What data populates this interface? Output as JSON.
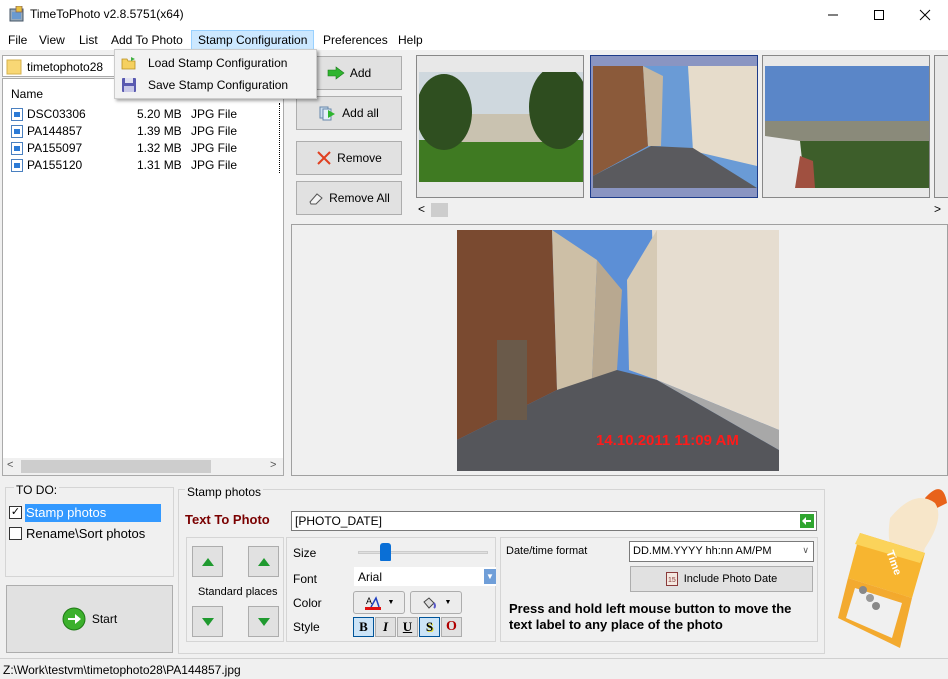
{
  "window": {
    "title": "TimeToPhoto v2.8.5751(x64)",
    "controls": {
      "minimize": "—",
      "maximize": "☐",
      "close": "✕"
    }
  },
  "menu": {
    "items": [
      "File",
      "View",
      "List",
      "Add To Photo",
      "Stamp Configuration",
      "Preferences",
      "Help"
    ],
    "active_index": 4,
    "dropdown": [
      {
        "label": "Load Stamp Configuration",
        "icon": "folder-open-icon"
      },
      {
        "label": "Save Stamp Configuration",
        "icon": "floppy-disk-icon"
      }
    ]
  },
  "folder": {
    "name": "timetophoto28"
  },
  "file_list": {
    "columns": [
      "Name"
    ],
    "rows": [
      {
        "name": "DSC03306",
        "size": "5.20 MB",
        "type": "JPG File"
      },
      {
        "name": "PA144857",
        "size": "1.39 MB",
        "type": "JPG File"
      },
      {
        "name": "PA155097",
        "size": "1.32 MB",
        "type": "JPG File"
      },
      {
        "name": "PA155120",
        "size": "1.31 MB",
        "type": "JPG File"
      }
    ]
  },
  "side_buttons": {
    "add": "Add",
    "add_all": "Add all",
    "remove": "Remove",
    "remove_all": "Remove All"
  },
  "thumbnails": {
    "items": [
      {
        "scene": "park-palace"
      },
      {
        "scene": "street",
        "selected": true
      },
      {
        "scene": "city-panorama"
      }
    ]
  },
  "preview": {
    "stamp_text": "14.10.2011 11:09  AM",
    "stamp_color": "#ff1a1a"
  },
  "todo": {
    "title": "TO DO:",
    "options": [
      {
        "label": "Stamp photos",
        "checked": true,
        "selected": true
      },
      {
        "label": "Rename\\Sort photos",
        "checked": false,
        "selected": false
      }
    ],
    "start_label": "Start"
  },
  "stamp": {
    "group_title": "Stamp photos",
    "text_label": "Text To Photo",
    "text_value": "[PHOTO_DATE]",
    "standard_places_label": "Standard places",
    "size_label": "Size",
    "size_value": 0.18,
    "font_label": "Font",
    "font_value": "Arial",
    "color_label": "Color",
    "style_label": "Style",
    "style_buttons": [
      {
        "label": "B",
        "name": "bold",
        "active": true
      },
      {
        "label": "I",
        "name": "italic",
        "active": false
      },
      {
        "label": "U",
        "name": "underline",
        "active": false
      },
      {
        "label": "S",
        "name": "shadow",
        "active": true
      },
      {
        "label": "O",
        "name": "outline",
        "active": false
      }
    ],
    "datetime_label": "Date/time format",
    "datetime_value": "DD.MM.YYYY hh:nn  AM/PM",
    "include_date_label": "Include Photo Date",
    "hint": "Press and hold left mouse button to move the text label to any place of the photo",
    "accent_color": "#7a0000"
  },
  "status": {
    "path": "Z:\\Work\\testvm\\timetophoto28\\PA144857.jpg"
  }
}
